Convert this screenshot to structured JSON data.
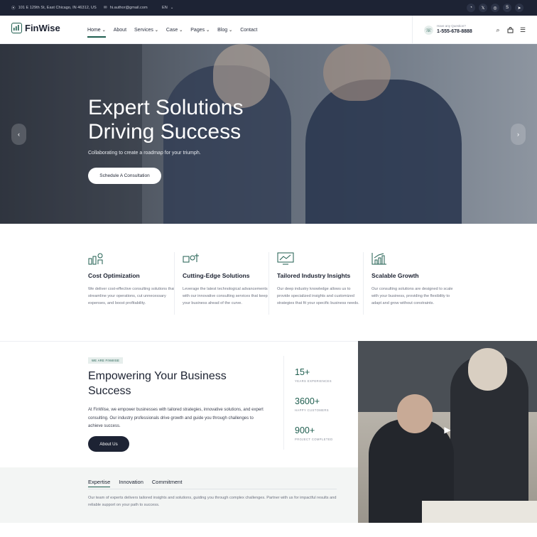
{
  "topbar": {
    "address": "101 E 129th St, East Chicago, IN 46312, US",
    "email": "hi.author@gmail.com",
    "language": "EN",
    "social_icons": [
      "whatsapp-icon",
      "x-icon",
      "instagram-icon",
      "skype-icon",
      "telegram-icon"
    ]
  },
  "nav": {
    "logo": "FinWise",
    "menu": [
      {
        "label": "Home",
        "dropdown": true,
        "active": true
      },
      {
        "label": "About",
        "dropdown": false
      },
      {
        "label": "Services",
        "dropdown": true
      },
      {
        "label": "Case",
        "dropdown": true
      },
      {
        "label": "Pages",
        "dropdown": true
      },
      {
        "label": "Blog",
        "dropdown": true
      },
      {
        "label": "Contact",
        "dropdown": false
      }
    ],
    "phone_label": "Have any Question?",
    "phone_number": "1-555-678-8888"
  },
  "hero": {
    "title_line1": "Expert Solutions",
    "title_line2": "Driving Success",
    "subtitle": "Collaborating to create a roadmap for your triumph.",
    "button": "Schedule A Consultation"
  },
  "features": [
    {
      "icon": "cost-optimization-icon",
      "title": "Cost Optimization",
      "desc": "We deliver cost-effective consulting solutions that streamline your operations, cut unnecessary expenses, and boost profitability."
    },
    {
      "icon": "innovation-icon",
      "title": "Cutting-Edge Solutions",
      "desc": "Leverage the latest technological advancements with our innovative consulting services that keep your business ahead of the curve."
    },
    {
      "icon": "analytics-icon",
      "title": "Tailored Industry Insights",
      "desc": "Our deep industry knowledge allows us to provide specialized insights and customized strategies that fit your specific business needs."
    },
    {
      "icon": "growth-chart-icon",
      "title": "Scalable Growth",
      "desc": "Our consulting solutions are designed to scale with your business, providing the flexibility to adapt and grow without constraints."
    }
  ],
  "about": {
    "tag": "WE ARE FINWISE",
    "title": "Empowering Your Business Success",
    "desc": "At FinWise, we empower businesses with tailored strategies, innovative solutions, and expert consulting. Our industry professionals drive growth and guide you through challenges to achieve success.",
    "button": "About Us",
    "stats": [
      {
        "value": "15+",
        "label": "YEARS EXPERIENCES"
      },
      {
        "value": "3600+",
        "label": "HAPPY CUSTOMERS"
      },
      {
        "value": "900+",
        "label": "PROJECT COMPLETED"
      }
    ]
  },
  "tabs": {
    "items": [
      "Expertise",
      "Innovation",
      "Commitment"
    ],
    "active": "Expertise",
    "desc": "Our team of experts delivers tailored insights and solutions, guiding you through complex challenges. Partner with us for impactful results and reliable support on your path to success."
  },
  "colors": {
    "accent": "#1f5e4f",
    "dark": "#1d2334"
  }
}
